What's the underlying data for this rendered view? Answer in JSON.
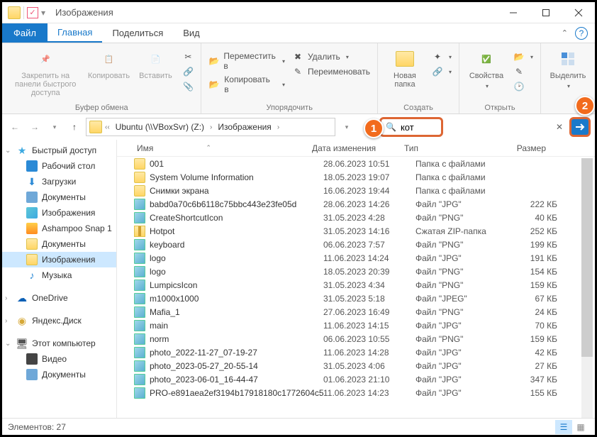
{
  "window_title": "Изображения",
  "tabs": {
    "file": "Файл",
    "home": "Главная",
    "share": "Поделиться",
    "view": "Вид"
  },
  "ribbon": {
    "clipboard": {
      "pin": "Закрепить на панели быстрого доступа",
      "copy": "Копировать",
      "paste": "Вставить",
      "label": "Буфер обмена"
    },
    "organize": {
      "moveto": "Переместить в",
      "copyto": "Копировать в",
      "delete": "Удалить",
      "rename": "Переименовать",
      "label": "Упорядочить"
    },
    "new": {
      "newfolder": "Новая папка",
      "label": "Создать"
    },
    "open": {
      "properties": "Свойства",
      "label": "Открыть"
    },
    "select": {
      "select": "Выделить",
      "label": ""
    }
  },
  "breadcrumb": [
    "Ubuntu (\\\\VBoxSvr) (Z:)",
    "Изображения"
  ],
  "search_value": "кот",
  "columns": {
    "name": "Имя",
    "date": "Дата изменения",
    "type": "Тип",
    "size": "Размер"
  },
  "sidebar": {
    "quick": "Быстрый доступ",
    "desktop": "Рабочий стол",
    "downloads": "Загрузки",
    "documents": "Документы",
    "images": "Изображения",
    "snap": "Ashampoo Snap 1",
    "documents2": "Документы",
    "images2": "Изображения",
    "music": "Музыка",
    "onedrive": "OneDrive",
    "yandex": "Яндекс.Диск",
    "thispc": "Этот компьютер",
    "video": "Видео",
    "documents3": "Документы"
  },
  "type_labels": {
    "folder": "Папка с файлами",
    "jpg": "Файл \"JPG\"",
    "png": "Файл \"PNG\"",
    "jpeg": "Файл \"JPEG\"",
    "zip": "Сжатая ZIP-папка"
  },
  "files": [
    {
      "ic": "folder",
      "name": "001",
      "date": "28.06.2023 10:51",
      "type": "folder",
      "size": ""
    },
    {
      "ic": "folder",
      "name": "System Volume Information",
      "date": "18.05.2023 19:07",
      "type": "folder",
      "size": ""
    },
    {
      "ic": "folder",
      "name": "Снимки экрана",
      "date": "16.06.2023 19:44",
      "type": "folder",
      "size": ""
    },
    {
      "ic": "img",
      "name": "babd0a70c6b6118c75bbc443e23fe05d",
      "date": "28.06.2023 14:26",
      "type": "jpg",
      "size": "222 КБ"
    },
    {
      "ic": "img",
      "name": "CreateShortcutIcon",
      "date": "31.05.2023 4:28",
      "type": "png",
      "size": "40 КБ"
    },
    {
      "ic": "zip",
      "name": "Hotpot",
      "date": "31.05.2023 14:16",
      "type": "zip",
      "size": "252 КБ"
    },
    {
      "ic": "img",
      "name": "keyboard",
      "date": "06.06.2023 7:57",
      "type": "png",
      "size": "199 КБ"
    },
    {
      "ic": "img",
      "name": "logo",
      "date": "11.06.2023 14:24",
      "type": "jpg",
      "size": "191 КБ"
    },
    {
      "ic": "img",
      "name": "logo",
      "date": "18.05.2023 20:39",
      "type": "png",
      "size": "154 КБ"
    },
    {
      "ic": "img",
      "name": "LumpicsIcon",
      "date": "31.05.2023 4:34",
      "type": "png",
      "size": "159 КБ"
    },
    {
      "ic": "img",
      "name": "m1000x1000",
      "date": "31.05.2023 5:18",
      "type": "jpeg",
      "size": "67 КБ"
    },
    {
      "ic": "img",
      "name": "Mafia_1",
      "date": "27.06.2023 16:49",
      "type": "png",
      "size": "24 КБ"
    },
    {
      "ic": "img",
      "name": "main",
      "date": "11.06.2023 14:15",
      "type": "jpg",
      "size": "70 КБ"
    },
    {
      "ic": "img",
      "name": "norm",
      "date": "06.06.2023 10:55",
      "type": "png",
      "size": "159 КБ"
    },
    {
      "ic": "img",
      "name": "photo_2022-11-27_07-19-27",
      "date": "11.06.2023 14:28",
      "type": "jpg",
      "size": "42 КБ"
    },
    {
      "ic": "img",
      "name": "photo_2023-05-27_20-55-14",
      "date": "31.05.2023 4:06",
      "type": "jpg",
      "size": "27 КБ"
    },
    {
      "ic": "img",
      "name": "photo_2023-06-01_16-44-47",
      "date": "01.06.2023 21:10",
      "type": "jpg",
      "size": "347 КБ"
    },
    {
      "ic": "img",
      "name": "PRO-e891aea2ef3194b17918180c1772604c5",
      "date": "11.06.2023 14:23",
      "type": "jpg",
      "size": "155 КБ"
    }
  ],
  "status": {
    "elements_label": "Элементов:",
    "elements_count": "27"
  },
  "callouts": {
    "c1": "1",
    "c2": "2"
  }
}
